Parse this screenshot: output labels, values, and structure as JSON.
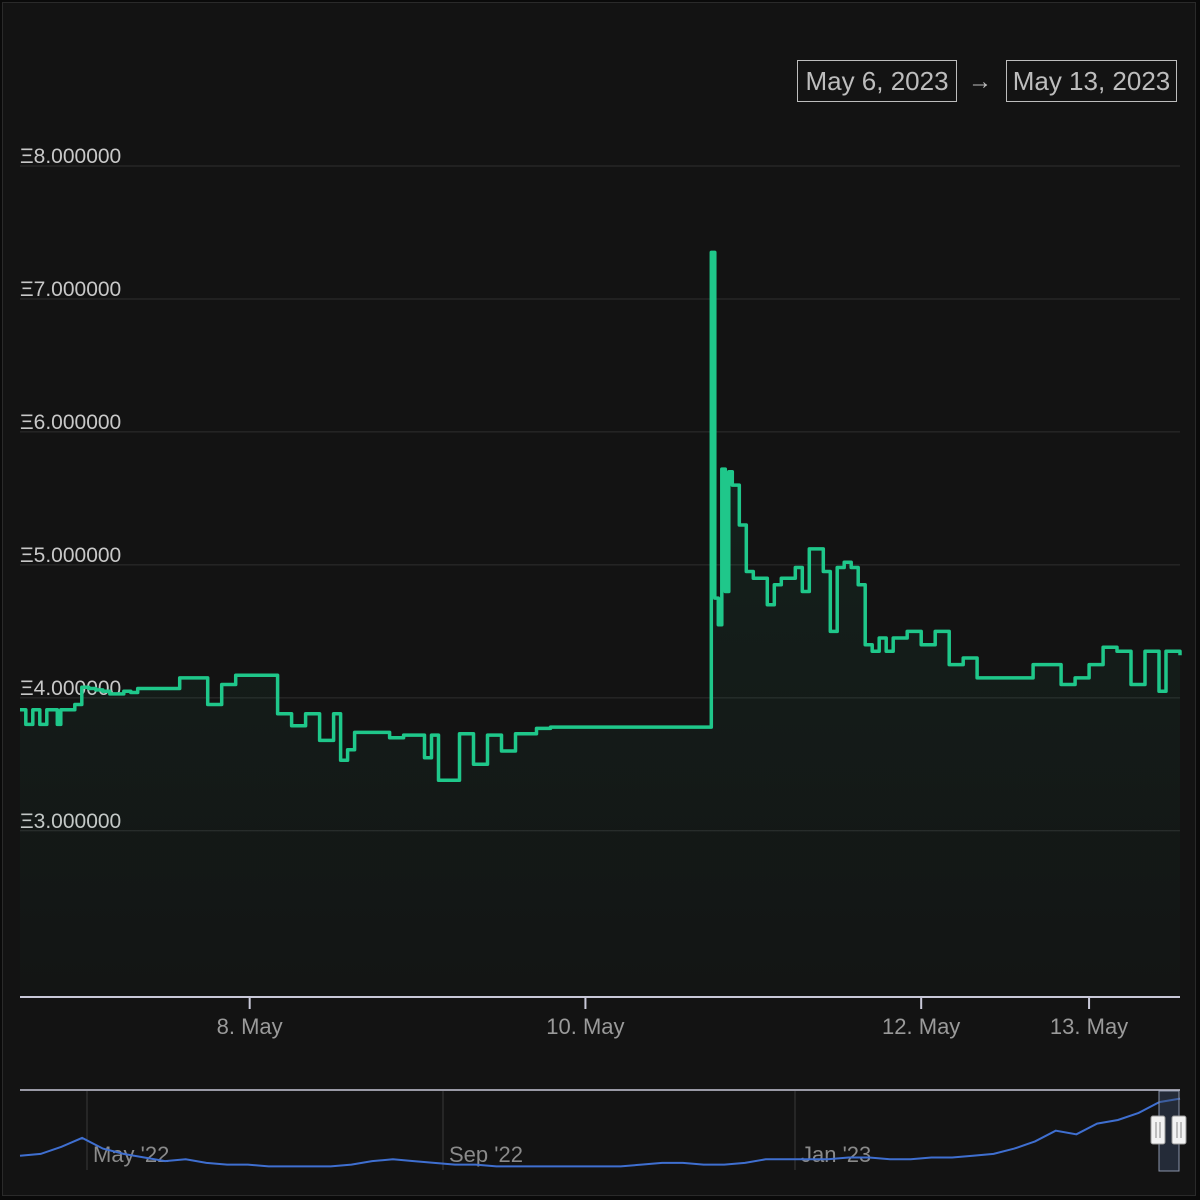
{
  "range_selector": {
    "from": "May 6, 2023",
    "arrow": "→",
    "to": "May 13, 2023"
  },
  "colors": {
    "line": "#1fc78a",
    "grid": "#2f2f2f",
    "navigator_line": "#3f6fd0",
    "background": "#131313"
  },
  "chart_data": {
    "type": "line",
    "title": "",
    "xlabel": "",
    "ylabel": "",
    "y_tick_labels": [
      "Ξ8.000000",
      "Ξ7.000000",
      "Ξ6.000000",
      "Ξ5.000000",
      "Ξ4.000000",
      "Ξ3.000000"
    ],
    "y_ticks": [
      8,
      7,
      6,
      5,
      4,
      3
    ],
    "ylim": [
      1.75,
      8.0
    ],
    "x_tick_labels": [
      "8. May",
      "10. May",
      "12. May",
      "13. May"
    ],
    "x_ticks": [
      "2023-05-08",
      "2023-05-10",
      "2023-05-12",
      "2023-05-13"
    ],
    "x_range": [
      "2023-05-06T15:10",
      "2023-05-13T13:00"
    ],
    "grid": true,
    "legend": "none",
    "series": [
      {
        "x": [
          "2023-05-06T15:10",
          "2023-05-06T16:00",
          "2023-05-06T17:00",
          "2023-05-06T18:00",
          "2023-05-06T19:00",
          "2023-05-06T20:30",
          "2023-05-06T21:00",
          "2023-05-06T22:00",
          "2023-05-06T23:00",
          "2023-05-07T00:00",
          "2023-05-07T01:00",
          "2023-05-07T02:00",
          "2023-05-07T03:00",
          "2023-05-07T04:00",
          "2023-05-07T06:00",
          "2023-05-07T07:00",
          "2023-05-07T08:00",
          "2023-05-07T10:00",
          "2023-05-07T12:00",
          "2023-05-07T14:00",
          "2023-05-07T16:00",
          "2023-05-07T18:00",
          "2023-05-07T20:00",
          "2023-05-07T21:00",
          "2023-05-07T22:00",
          "2023-05-07T23:00",
          "2023-05-08T00:00",
          "2023-05-08T01:00",
          "2023-05-08T02:00",
          "2023-05-08T04:00",
          "2023-05-08T06:00",
          "2023-05-08T08:00",
          "2023-05-08T10:00",
          "2023-05-08T12:00",
          "2023-05-08T13:00",
          "2023-05-08T14:00",
          "2023-05-08T15:00",
          "2023-05-08T16:00",
          "2023-05-08T18:00",
          "2023-05-08T20:00",
          "2023-05-08T22:00",
          "2023-05-09T00:00",
          "2023-05-09T01:00",
          "2023-05-09T02:00",
          "2023-05-09T03:00",
          "2023-05-09T04:00",
          "2023-05-09T06:00",
          "2023-05-09T08:00",
          "2023-05-09T10:00",
          "2023-05-09T12:00",
          "2023-05-09T14:00",
          "2023-05-09T16:00",
          "2023-05-09T17:00",
          "2023-05-09T18:00",
          "2023-05-09T19:00",
          "2023-05-09T20:00",
          "2023-05-09T21:00",
          "2023-05-09T22:00",
          "2023-05-09T23:00",
          "2023-05-10T00:00",
          "2023-05-10T02:00",
          "2023-05-10T04:00",
          "2023-05-10T06:00",
          "2023-05-10T08:00",
          "2023-05-10T10:00",
          "2023-05-10T12:00",
          "2023-05-10T14:00",
          "2023-05-10T16:00",
          "2023-05-10T17:00",
          "2023-05-10T18:00",
          "2023-05-10T18:30",
          "2023-05-10T19:00",
          "2023-05-10T19:30",
          "2023-05-10T20:00",
          "2023-05-10T20:30",
          "2023-05-10T21:00",
          "2023-05-10T22:00",
          "2023-05-10T23:00",
          "2023-05-11T00:00",
          "2023-05-11T01:00",
          "2023-05-11T02:00",
          "2023-05-11T03:00",
          "2023-05-11T04:00",
          "2023-05-11T05:00",
          "2023-05-11T06:00",
          "2023-05-11T07:00",
          "2023-05-11T08:00",
          "2023-05-11T09:00",
          "2023-05-11T10:00",
          "2023-05-11T11:00",
          "2023-05-11T12:00",
          "2023-05-11T13:00",
          "2023-05-11T14:00",
          "2023-05-11T15:00",
          "2023-05-11T16:00",
          "2023-05-11T17:00",
          "2023-05-11T18:00",
          "2023-05-11T19:00",
          "2023-05-11T20:00",
          "2023-05-11T22:00",
          "2023-05-12T00:00",
          "2023-05-12T02:00",
          "2023-05-12T04:00",
          "2023-05-12T06:00",
          "2023-05-12T08:00",
          "2023-05-12T10:00",
          "2023-05-12T12:00",
          "2023-05-12T14:00",
          "2023-05-12T16:00",
          "2023-05-12T18:00",
          "2023-05-12T20:00",
          "2023-05-12T22:00",
          "2023-05-13T00:00",
          "2023-05-13T01:00",
          "2023-05-13T02:00",
          "2023-05-13T03:00",
          "2023-05-13T04:00",
          "2023-05-13T06:00",
          "2023-05-13T08:00",
          "2023-05-13T10:00",
          "2023-05-13T11:00",
          "2023-05-13T12:00",
          "2023-05-13T13:00"
        ],
        "y": [
          3.91,
          3.8,
          3.91,
          3.8,
          3.91,
          3.8,
          3.91,
          3.91,
          3.95,
          4.08,
          4.07,
          4.06,
          4.05,
          4.03,
          4.05,
          4.04,
          4.07,
          4.07,
          4.07,
          4.15,
          4.15,
          3.95,
          4.1,
          4.1,
          4.17,
          4.17,
          4.17,
          4.17,
          4.17,
          3.88,
          3.79,
          3.88,
          3.68,
          3.88,
          3.53,
          3.61,
          3.74,
          3.74,
          3.74,
          3.7,
          3.72,
          3.72,
          3.55,
          3.72,
          3.38,
          3.38,
          3.73,
          3.5,
          3.72,
          3.6,
          3.73,
          3.73,
          3.77,
          3.77,
          3.78,
          3.78,
          3.78,
          3.78,
          3.78,
          3.78,
          3.78,
          3.78,
          3.78,
          3.78,
          3.78,
          3.78,
          3.78,
          3.78,
          3.78,
          7.35,
          4.75,
          4.55,
          5.72,
          4.8,
          5.7,
          5.6,
          5.3,
          4.95,
          4.9,
          4.9,
          4.7,
          4.85,
          4.9,
          4.9,
          4.98,
          4.8,
          5.12,
          5.12,
          4.95,
          4.5,
          4.98,
          5.02,
          4.98,
          4.85,
          4.4,
          4.35,
          4.45,
          4.35,
          4.45,
          4.5,
          4.4,
          4.5,
          4.25,
          4.3,
          4.15,
          4.15,
          4.15,
          4.15,
          4.25,
          4.25,
          4.1,
          4.15,
          4.25,
          4.25,
          4.38,
          4.38,
          4.35,
          4.1,
          4.35,
          4.05,
          4.35,
          4.35,
          4.32
        ]
      }
    ]
  },
  "navigator": {
    "x_tick_labels": [
      "May '22",
      "Sep '22",
      "Jan '23"
    ],
    "values": [
      3.8,
      3.9,
      4.3,
      4.8,
      4.2,
      3.9,
      3.7,
      3.5,
      3.6,
      3.4,
      3.3,
      3.3,
      3.2,
      3.2,
      3.2,
      3.2,
      3.3,
      3.5,
      3.6,
      3.5,
      3.4,
      3.3,
      3.3,
      3.2,
      3.2,
      3.2,
      3.2,
      3.2,
      3.2,
      3.2,
      3.3,
      3.4,
      3.4,
      3.3,
      3.3,
      3.4,
      3.6,
      3.6,
      3.6,
      3.6,
      3.7,
      3.7,
      3.6,
      3.6,
      3.7,
      3.7,
      3.8,
      3.9,
      4.2,
      4.6,
      5.2,
      5.0,
      5.6,
      5.8,
      6.2,
      6.8,
      7.0
    ]
  }
}
